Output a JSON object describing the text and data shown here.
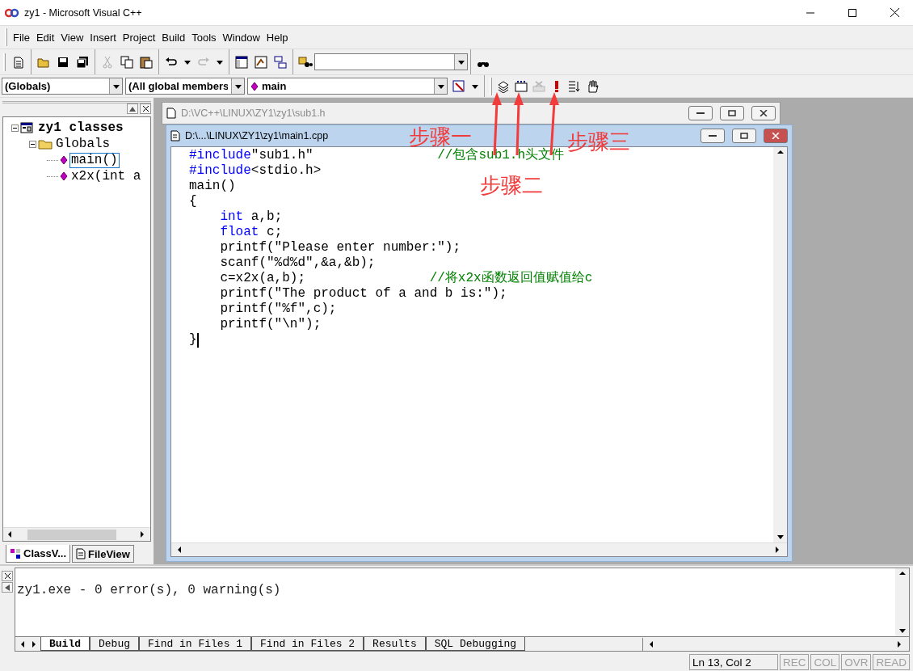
{
  "window": {
    "title": "zy1 - Microsoft Visual C++"
  },
  "menu": [
    "File",
    "Edit",
    "View",
    "Insert",
    "Project",
    "Build",
    "Tools",
    "Window",
    "Help"
  ],
  "wizard_bar": {
    "class_combo": "(Globals)",
    "filter_combo": "(All global members",
    "member_combo": "main"
  },
  "workspace": {
    "tree": [
      {
        "label": "zy1 classes",
        "kind": "project",
        "expanded": true,
        "selected": false,
        "children": [
          {
            "label": "Globals",
            "kind": "folder",
            "expanded": true,
            "selected": false,
            "children": [
              {
                "label": "main()",
                "kind": "function",
                "selected": true
              },
              {
                "label": "x2x(int a",
                "kind": "function",
                "selected": false
              }
            ]
          }
        ]
      }
    ],
    "tabs": [
      {
        "label": "ClassV...",
        "kind": "classes",
        "selected": true
      },
      {
        "label": "FileView",
        "kind": "files",
        "selected": false
      }
    ]
  },
  "documents": [
    {
      "title": "D:\\VC++\\LINUX\\ZY1\\zy1\\sub1.h",
      "kind": "header",
      "active": false
    },
    {
      "title": "D:\\...\\LINUX\\ZY1\\zy1\\main1.cpp",
      "kind": "source",
      "active": true
    }
  ],
  "code": [
    [
      {
        "kind": "keyword",
        "text": "#include"
      },
      {
        "kind": "text",
        "text": "\"sub1.h\"                "
      },
      {
        "kind": "comment",
        "text": "//包含sub1.h头文件"
      }
    ],
    [
      {
        "kind": "keyword",
        "text": "#include"
      },
      {
        "kind": "text",
        "text": "<stdio.h>"
      }
    ],
    [
      {
        "kind": "text",
        "text": "main()"
      }
    ],
    [
      {
        "kind": "text",
        "text": "{"
      }
    ],
    [
      {
        "kind": "keyword",
        "text": "    int"
      },
      {
        "kind": "text",
        "text": " a,b;"
      }
    ],
    [
      {
        "kind": "keyword",
        "text": "    float"
      },
      {
        "kind": "text",
        "text": " c;"
      }
    ],
    [
      {
        "kind": "text",
        "text": "    printf(\"Please enter number:\");"
      }
    ],
    [
      {
        "kind": "text",
        "text": "    scanf(\"%d%d\",&a,&b);"
      }
    ],
    [
      {
        "kind": "text",
        "text": "    c=x2x(a,b);                "
      },
      {
        "kind": "comment",
        "text": "//将x2x函数返回值赋值给c"
      }
    ],
    [
      {
        "kind": "text",
        "text": "    printf(\"The product of a and b is:\");"
      }
    ],
    [
      {
        "kind": "text",
        "text": "    printf(\"%f\",c);"
      }
    ],
    [
      {
        "kind": "text",
        "text": "    printf(\"\\n\");"
      }
    ],
    [
      {
        "kind": "text",
        "text": "}"
      }
    ]
  ],
  "annotations": [
    "步骤一",
    "步骤二",
    "步骤三"
  ],
  "output": {
    "lines": [
      "zy1.exe - 0 error(s), 0 warning(s)"
    ],
    "tabs": [
      {
        "label": "Build",
        "selected": true
      },
      {
        "label": "Debug",
        "selected": false
      },
      {
        "label": "Find in Files 1",
        "selected": false
      },
      {
        "label": "Find in Files 2",
        "selected": false
      },
      {
        "label": "Results",
        "selected": false
      },
      {
        "label": "SQL Debugging",
        "selected": false
      }
    ]
  },
  "status_bar": {
    "position": "Ln 13, Col 2",
    "indicators": [
      {
        "label": "REC",
        "on": false
      },
      {
        "label": "COL",
        "on": false
      },
      {
        "label": "OVR",
        "on": false
      },
      {
        "label": "READ",
        "on": false
      }
    ]
  }
}
